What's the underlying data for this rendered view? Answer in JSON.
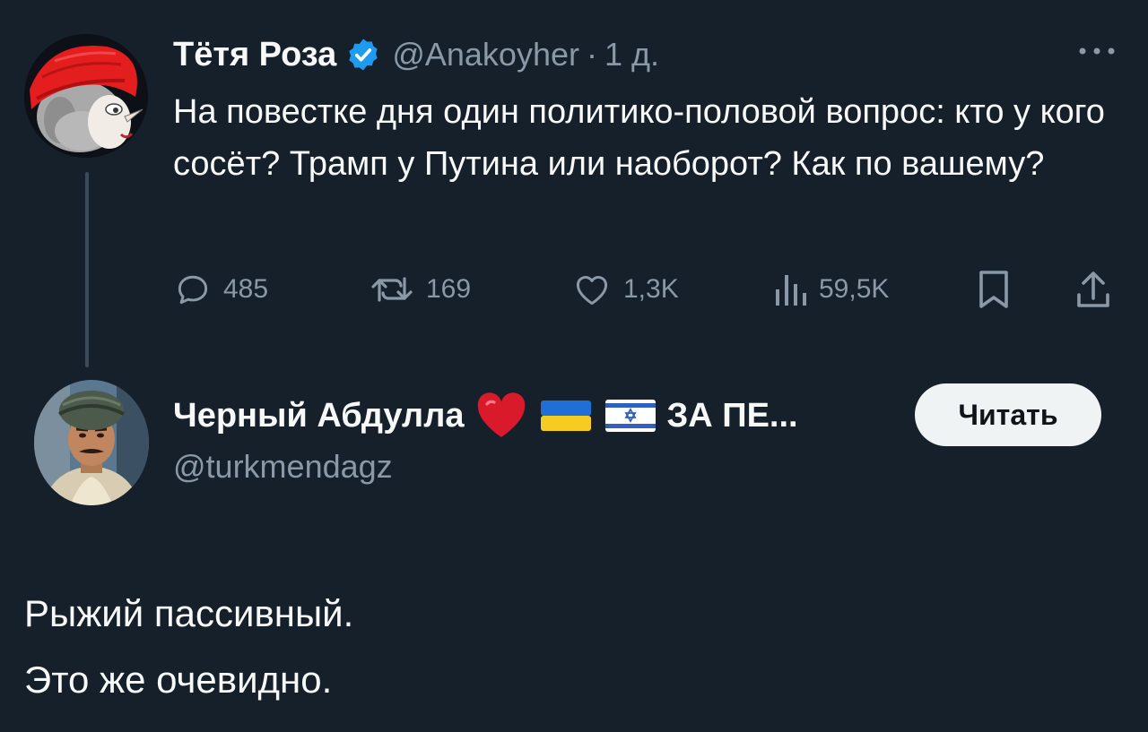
{
  "original_tweet": {
    "author_name": "Тётя Роза",
    "handle": "@Anakoyher",
    "separator": "·",
    "time": "1 д.",
    "text": "На повестке дня один политико-половой вопрос: кто у кого сосёт? Трамп у Путина или наоборот? Как по вашему?",
    "more_icon": "ellipsis-icon",
    "verified_icon": "verified-badge-icon",
    "actions": {
      "replies": "485",
      "retweets": "169",
      "likes": "1,3K",
      "views": "59,5K",
      "reply_icon": "comment-icon",
      "retweet_icon": "retweet-icon",
      "like_icon": "heart-icon",
      "views_icon": "analytics-icon",
      "bookmark_icon": "bookmark-icon",
      "share_icon": "share-icon"
    }
  },
  "reply": {
    "author_name": "Черный Абдулла",
    "name_suffix": "ЗА ПЕ...",
    "emojis": [
      "red-heart",
      "ukraine-flag",
      "israel-flag"
    ],
    "handle": "@turkmendagz",
    "follow_label": "Читать",
    "text_lines": [
      "Рыжий пассивный.",
      "Это же очевидно."
    ]
  },
  "colors": {
    "background": "#15202b",
    "primary_text": "#f7f9f9",
    "secondary_text": "#8b98a5",
    "verified_blue": "#1d9bf0",
    "thread_line": "#3e4a56",
    "button_bg": "#eff3f4",
    "button_text": "#0f1419"
  }
}
